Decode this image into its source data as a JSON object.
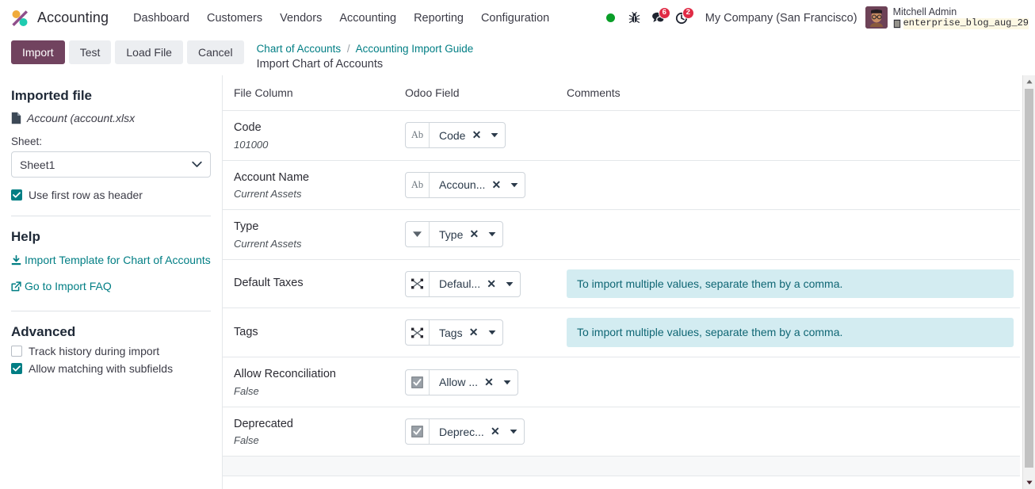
{
  "navbar": {
    "brand": "Accounting",
    "logo_icon": "odoo-logo",
    "menu": [
      "Dashboard",
      "Customers",
      "Vendors",
      "Accounting",
      "Reporting",
      "Configuration"
    ],
    "status_dot_color": "#0a9e28",
    "icons": [
      {
        "name": "bug-icon",
        "glyph": "bug"
      },
      {
        "name": "messages-icon",
        "glyph": "chat",
        "badge": "6"
      },
      {
        "name": "activities-icon",
        "glyph": "clock",
        "badge": "2"
      }
    ],
    "company": "My Company (San Francisco)",
    "user_name": "Mitchell Admin",
    "database": "enterprise_blog_aug_29",
    "database_icon": "database-icon"
  },
  "control_panel": {
    "buttons": [
      {
        "label": "Import",
        "style": "primary",
        "name": "import-button"
      },
      {
        "label": "Test",
        "style": "secondary",
        "name": "test-button"
      },
      {
        "label": "Load File",
        "style": "secondary",
        "name": "load-file-button"
      },
      {
        "label": "Cancel",
        "style": "secondary",
        "name": "cancel-button"
      }
    ],
    "breadcrumb": {
      "first": "Chart of Accounts",
      "separator": "/",
      "second": "Accounting Import Guide"
    },
    "page_title": "Import Chart of Accounts"
  },
  "sidebar": {
    "imported_file_heading": "Imported file",
    "file_name": "Account (account.xlsx",
    "file_icon": "file-icon",
    "sheet_label": "Sheet:",
    "sheet_value": "Sheet1",
    "sheet_options": [
      "Sheet1"
    ],
    "use_first_row_label": "Use first row as header",
    "use_first_row_checked": true,
    "help_heading": "Help",
    "help_links": [
      {
        "label": "Import Template for Chart of Accounts",
        "icon": "download-icon"
      },
      {
        "label": "Go to Import FAQ",
        "icon": "external-link-icon"
      }
    ],
    "advanced_heading": "Advanced",
    "advanced_options": [
      {
        "label": "Track history during import",
        "checked": false
      },
      {
        "label": "Allow matching with subfields",
        "checked": true
      }
    ]
  },
  "table": {
    "headers": {
      "file_column": "File Column",
      "odoo_field": "Odoo Field",
      "comments": "Comments"
    },
    "rows": [
      {
        "file_column": "Code",
        "sample": "101000",
        "field_label": "Code",
        "field_type_icon": "text-field-icon",
        "comment": ""
      },
      {
        "file_column": "Account Name",
        "sample": "Current Assets",
        "field_label": "Accoun...",
        "field_type_icon": "text-field-icon",
        "comment": ""
      },
      {
        "file_column": "Type",
        "sample": "Current Assets",
        "field_label": "Type",
        "field_type_icon": "selection-field-icon",
        "comment": ""
      },
      {
        "file_column": "Default Taxes",
        "sample": "",
        "field_label": "Defaul...",
        "field_type_icon": "many2many-field-icon",
        "comment": "To import multiple values, separate them by a comma."
      },
      {
        "file_column": "Tags",
        "sample": "",
        "field_label": "Tags",
        "field_type_icon": "many2many-field-icon",
        "comment": "To import multiple values, separate them by a comma."
      },
      {
        "file_column": "Allow Reconciliation",
        "sample": "False",
        "field_label": "Allow ...",
        "field_type_icon": "boolean-field-icon",
        "comment": ""
      },
      {
        "file_column": "Deprecated",
        "sample": "False",
        "field_label": "Deprec...",
        "field_type_icon": "boolean-field-icon",
        "comment": ""
      }
    ],
    "clear_icon": "clear-field-icon",
    "dropdown_icon": "chevron-down-icon"
  },
  "colors": {
    "primary": "#71435f",
    "accent_teal": "#017e84",
    "comment_bg": "#d3ecf1",
    "comment_text": "#0f6674",
    "badge_red": "#e02b45",
    "status_green": "#0a9e28"
  }
}
